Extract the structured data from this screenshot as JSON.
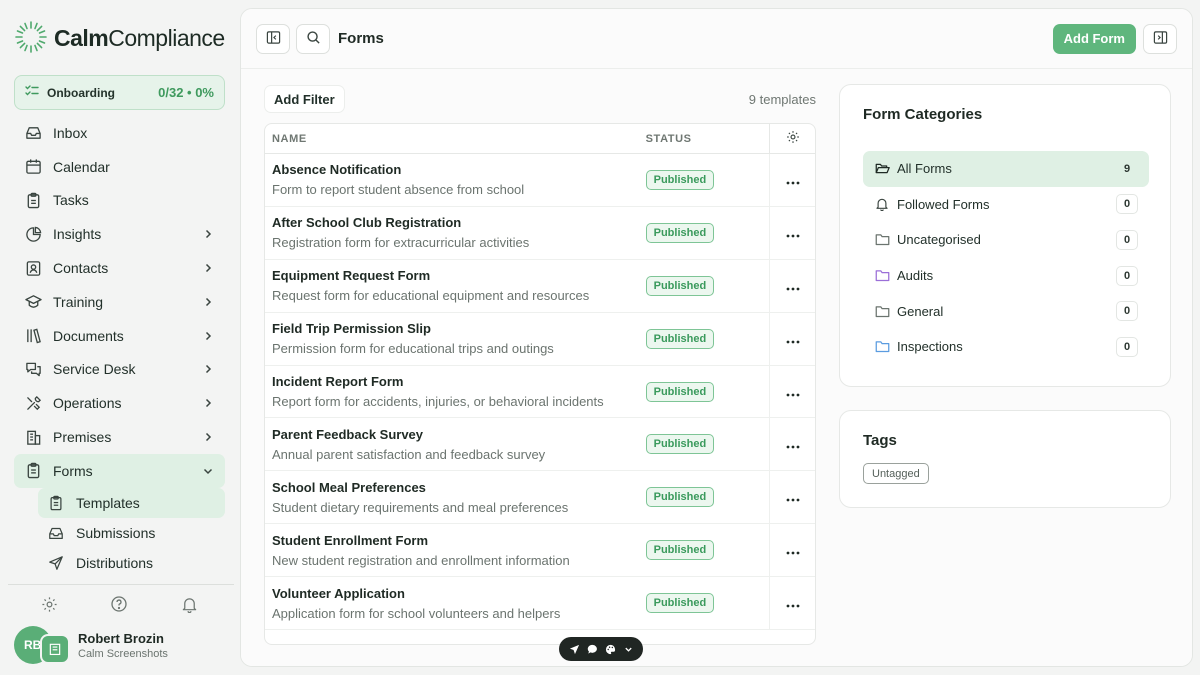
{
  "brand": {
    "name_bold": "Calm",
    "name_light": "Compliance",
    "accent": "#5fb67d"
  },
  "onboarding": {
    "label": "Onboarding",
    "progress": "0/32 • 0%"
  },
  "nav": [
    {
      "label": "Inbox",
      "icon": "inbox-icon",
      "chevron": false
    },
    {
      "label": "Calendar",
      "icon": "calendar-icon",
      "chevron": false
    },
    {
      "label": "Tasks",
      "icon": "clipboard-icon",
      "chevron": false
    },
    {
      "label": "Insights",
      "icon": "pie-chart-icon",
      "chevron": true
    },
    {
      "label": "Contacts",
      "icon": "contact-card-icon",
      "chevron": true
    },
    {
      "label": "Training",
      "icon": "graduation-cap-icon",
      "chevron": true
    },
    {
      "label": "Documents",
      "icon": "library-icon",
      "chevron": true
    },
    {
      "label": "Service Desk",
      "icon": "chat-bubbles-icon",
      "chevron": true
    },
    {
      "label": "Operations",
      "icon": "tools-icon",
      "chevron": true
    },
    {
      "label": "Premises",
      "icon": "building-icon",
      "chevron": true
    },
    {
      "label": "Forms",
      "icon": "form-icon",
      "chevron": true,
      "expanded": true
    }
  ],
  "forms_subnav": [
    {
      "label": "Templates",
      "icon": "template-icon",
      "active": true
    },
    {
      "label": "Submissions",
      "icon": "inbox-tray-icon"
    },
    {
      "label": "Distributions",
      "icon": "send-icon"
    }
  ],
  "user": {
    "initials": "RB",
    "name": "Robert Brozin",
    "org": "Calm Screenshots"
  },
  "header": {
    "title": "Forms",
    "add_button": "Add Form"
  },
  "filter": {
    "add_filter": "Add Filter",
    "count": "9 templates"
  },
  "table": {
    "columns": {
      "name": "NAME",
      "status": "STATUS"
    },
    "rows": [
      {
        "title": "Absence Notification",
        "desc": "Form to report student absence from school",
        "status": "Published"
      },
      {
        "title": "After School Club Registration",
        "desc": "Registration form for extracurricular activities",
        "status": "Published"
      },
      {
        "title": "Equipment Request Form",
        "desc": "Request form for educational equipment and resources",
        "status": "Published"
      },
      {
        "title": "Field Trip Permission Slip",
        "desc": "Permission form for educational trips and outings",
        "status": "Published"
      },
      {
        "title": "Incident Report Form",
        "desc": "Report form for accidents, injuries, or behavioral incidents",
        "status": "Published"
      },
      {
        "title": "Parent Feedback Survey",
        "desc": "Annual parent satisfaction and feedback survey",
        "status": "Published"
      },
      {
        "title": "School Meal Preferences",
        "desc": "Student dietary requirements and meal preferences",
        "status": "Published"
      },
      {
        "title": "Student Enrollment Form",
        "desc": "New student registration and enrollment information",
        "status": "Published"
      },
      {
        "title": "Volunteer Application",
        "desc": "Application form for school volunteers and helpers",
        "status": "Published"
      }
    ]
  },
  "categories": {
    "title": "Form Categories",
    "items": [
      {
        "label": "All Forms",
        "count": "9",
        "icon": "folder-open-icon",
        "active": true
      },
      {
        "label": "Followed Forms",
        "count": "0",
        "icon": "bell-icon"
      },
      {
        "label": "Uncategorised",
        "count": "0",
        "icon": "folder-icon",
        "color": "#6b746f"
      },
      {
        "label": "Audits",
        "count": "0",
        "icon": "folder-icon",
        "color": "#9b6fd8"
      },
      {
        "label": "General",
        "count": "0",
        "icon": "folder-icon",
        "color": "#6b746f"
      },
      {
        "label": "Inspections",
        "count": "0",
        "icon": "folder-icon",
        "color": "#5b9ce0"
      }
    ]
  },
  "tags": {
    "title": "Tags",
    "items": [
      "Untagged"
    ]
  }
}
